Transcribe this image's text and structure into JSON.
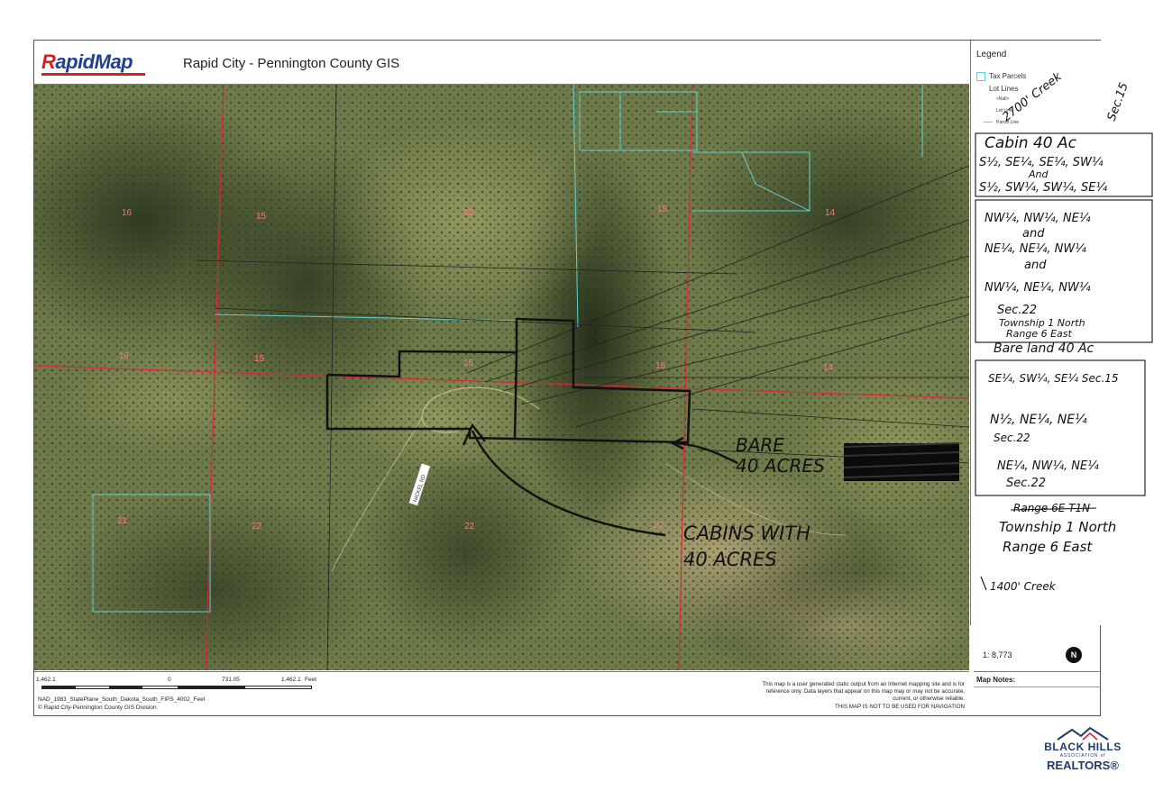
{
  "header": {
    "logo_text_r": "R",
    "logo_text_rest": "apidMap",
    "title": "Rapid City - Pennington County GIS"
  },
  "legend": {
    "title": "Legend",
    "items": [
      "Tax Parcels",
      "Lot Lines",
      "<Null>",
      "Lot Line",
      "Parcel Line"
    ]
  },
  "map": {
    "section_labels": [
      {
        "id": "s16a",
        "text": "16"
      },
      {
        "id": "s15a",
        "text": "15"
      },
      {
        "id": "s15b",
        "text": "15"
      },
      {
        "id": "s15c",
        "text": "15"
      },
      {
        "id": "s14a",
        "text": "14"
      },
      {
        "id": "s16b",
        "text": "16"
      },
      {
        "id": "s15d",
        "text": "15"
      },
      {
        "id": "s15e",
        "text": "15"
      },
      {
        "id": "s15f",
        "text": "15"
      },
      {
        "id": "s14b",
        "text": "14"
      },
      {
        "id": "s21",
        "text": "21"
      },
      {
        "id": "s22a",
        "text": "22"
      },
      {
        "id": "s22b",
        "text": "22"
      },
      {
        "id": "s22c",
        "text": "22"
      }
    ],
    "road_label": "NICKEL RD",
    "handwritten": {
      "creek_top": "2700' Creek",
      "sec15": "Sec.15",
      "cabin_title": "Cabin 40 Ac",
      "cabin_l1": "S½, SE¼, SE¼, SW¼",
      "cabin_and": "And",
      "cabin_l2": "S½, SW¼, SW¼, SE¼",
      "desc_l1": "NW¼, NW¼, NE¼",
      "desc_and1": "and",
      "desc_l2": "NE¼, NE¼, NW¼",
      "desc_and2": "and",
      "desc_l3": "NW¼, NE¼, NW¼",
      "desc_sec22": "Sec.22",
      "desc_twp": "Township 1 North",
      "desc_rng": "Range 6 East",
      "bare_title": "Bare land 40 Ac",
      "bare_l1": "SE¼, SW¼, SE¼ Sec.15",
      "bare_l2": "N½, NE¼, NE¼",
      "bare_l2b": "Sec.22",
      "bare_l3": "NE¼, NW¼, NE¼",
      "bare_l3b": "Sec.22",
      "struck": "Range 6E T1N",
      "twp2": "Township 1 North",
      "rng2": "Range 6 East",
      "creek_bottom": "1400' Creek",
      "bare_callout_1": "BARE",
      "bare_callout_2": "40 ACRES",
      "cabins_callout_1": "CABINS WITH",
      "cabins_callout_2": "40 ACRES"
    }
  },
  "scale": {
    "ratio": "1: 8,773",
    "north": "N",
    "labels": [
      "1,462.1",
      "0",
      "731.05",
      "1,462.1",
      "Feet"
    ]
  },
  "footer": {
    "projection": "NAD_1983_StatePlane_South_Dakota_South_FIPS_4002_Feet",
    "copyright": "© Rapid City-Pennington County GIS Division",
    "disclaimer_1": "This map is a user generated static output from an Internet mapping site and is for",
    "disclaimer_2": "reference only. Data layers that appear on this map may or may not be accurate,",
    "disclaimer_3": "current, or otherwise reliable.",
    "disclaimer_4": "THIS MAP IS NOT TO BE USED FOR NAVIGATION",
    "notes_title": "Map Notes:"
  },
  "brand": {
    "line1": "BLACK HILLS",
    "line2": "ASSOCIATION of",
    "line3": "REALTORS®"
  },
  "colors": {
    "section_line": "#d8283a",
    "parcel_line": "#5fd0d0",
    "label": "#e44a5a"
  }
}
